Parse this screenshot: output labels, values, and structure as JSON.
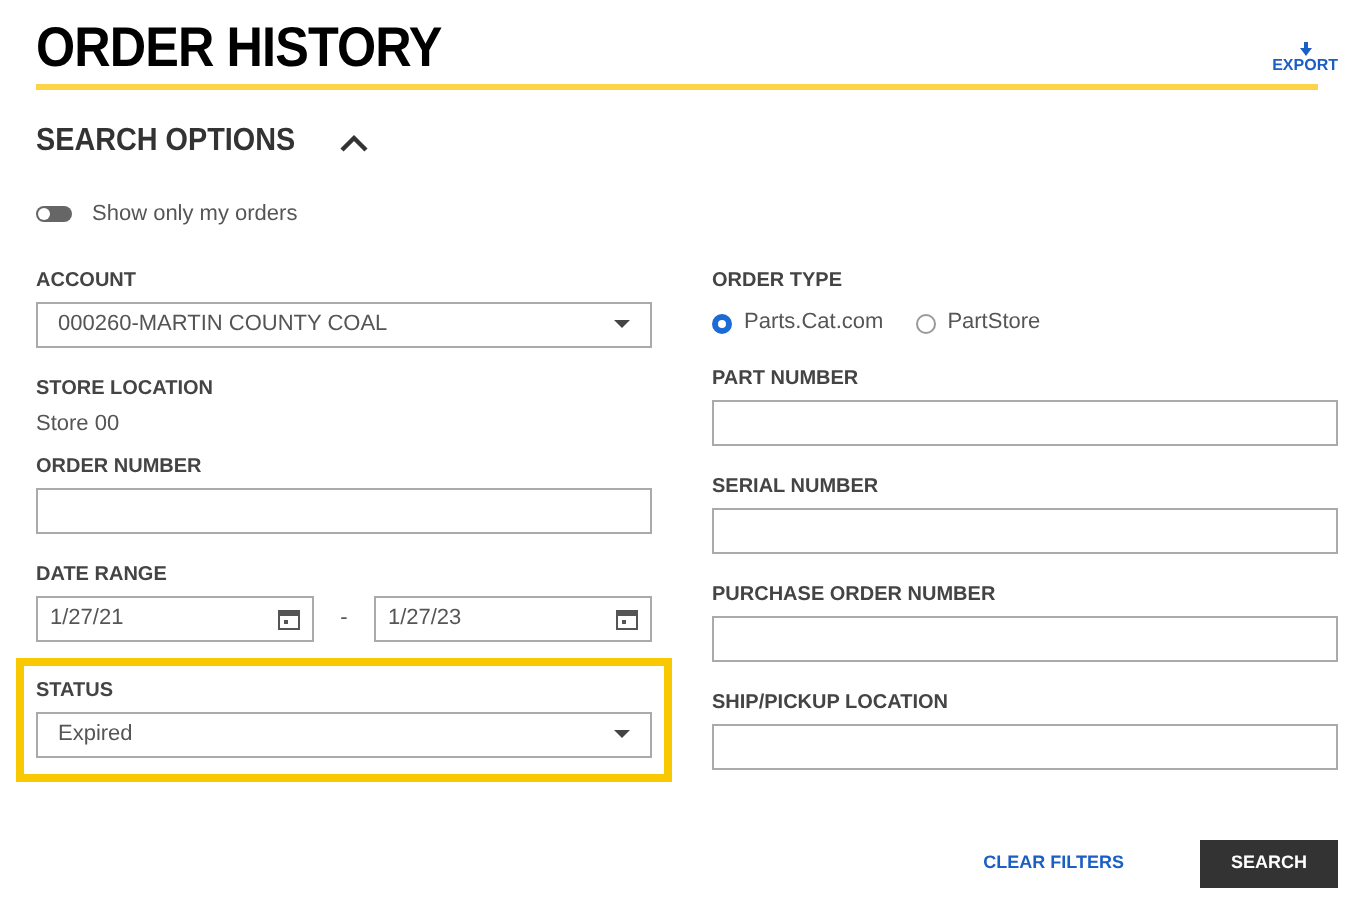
{
  "header": {
    "title": "ORDER HISTORY",
    "export_label": "EXPORT"
  },
  "search_options": {
    "title": "SEARCH OPTIONS",
    "expanded": true
  },
  "toggle": {
    "label": "Show only my orders",
    "on": false
  },
  "left": [
    {
      "kind": "select",
      "label": "ACCOUNT",
      "value": "000260-MARTIN COUNTY COAL",
      "highlighted": false
    },
    {
      "kind": "text",
      "label": "STORE LOCATION",
      "value": "Store 00"
    },
    {
      "kind": "input",
      "label": "ORDER NUMBER"
    },
    {
      "kind": "daterange",
      "label": "DATE RANGE",
      "from": "1/27/21",
      "separator": "-",
      "to": "1/27/23"
    },
    {
      "kind": "select",
      "label": "STATUS",
      "value": "Expired",
      "highlighted": true
    }
  ],
  "right": [
    {
      "kind": "radios",
      "label": "ORDER TYPE",
      "options": [
        {
          "label": "Parts.Cat.com",
          "selected": true
        },
        {
          "label": "PartStore",
          "selected": false
        }
      ]
    },
    {
      "kind": "input",
      "label": "PART NUMBER"
    },
    {
      "kind": "input",
      "label": "SERIAL NUMBER"
    },
    {
      "kind": "input",
      "label": "PURCHASE ORDER NUMBER"
    },
    {
      "kind": "input",
      "label": "SHIP/PICKUP LOCATION"
    }
  ],
  "actions": {
    "clear": "CLEAR FILTERS",
    "search": "SEARCH"
  }
}
